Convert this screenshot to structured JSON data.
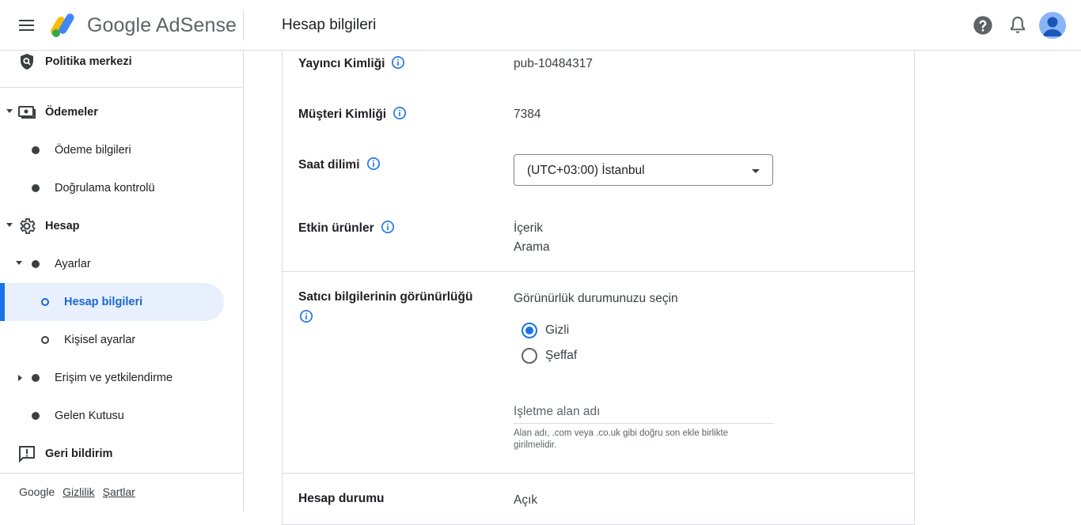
{
  "header": {
    "brand": "Google AdSense",
    "page_title": "Hesap bilgileri"
  },
  "sidebar": {
    "items": [
      {
        "label": "Politika merkezi"
      },
      {
        "label": "Ödemeler"
      },
      {
        "label": "Ödeme bilgileri"
      },
      {
        "label": "Doğrulama kontrolü"
      },
      {
        "label": "Hesap"
      },
      {
        "label": "Ayarlar"
      },
      {
        "label": "Hesap bilgileri"
      },
      {
        "label": "Kişisel ayarlar"
      },
      {
        "label": "Erişim ve yetkilendirme"
      },
      {
        "label": "Gelen Kutusu"
      },
      {
        "label": "Geri bildirim"
      }
    ],
    "footer": {
      "google": "Google",
      "privacy": "Gizlilik",
      "terms": "Şartlar"
    }
  },
  "main": {
    "publisher_id": {
      "label": "Yayıncı Kimliği",
      "value": "pub-10484317"
    },
    "customer_id": {
      "label": "Müşteri Kimliği",
      "value": "7384"
    },
    "timezone": {
      "label": "Saat dilimi",
      "value": "(UTC+03:00) İstanbul"
    },
    "active_products": {
      "label": "Etkin ürünler",
      "values": [
        "İçerik",
        "Arama"
      ]
    },
    "seller_visibility": {
      "label": "Satıcı bilgilerinin görünürlüğü",
      "prompt": "Görünürlük durumunuzu seçin",
      "options": [
        {
          "label": "Gizli",
          "checked": true
        },
        {
          "label": "Şeffaf",
          "checked": false
        }
      ],
      "domain_placeholder": "İşletme alan adı",
      "domain_hint": "Alan adı, .com veya .co.uk gibi doğru son ekle birlikte girilmelidir."
    },
    "account_status": {
      "label": "Hesap durumu",
      "value": "Açık"
    }
  },
  "colors": {
    "accent": "#1a73e8",
    "active_bg": "#e8f0fe",
    "divider": "#dadce0"
  }
}
